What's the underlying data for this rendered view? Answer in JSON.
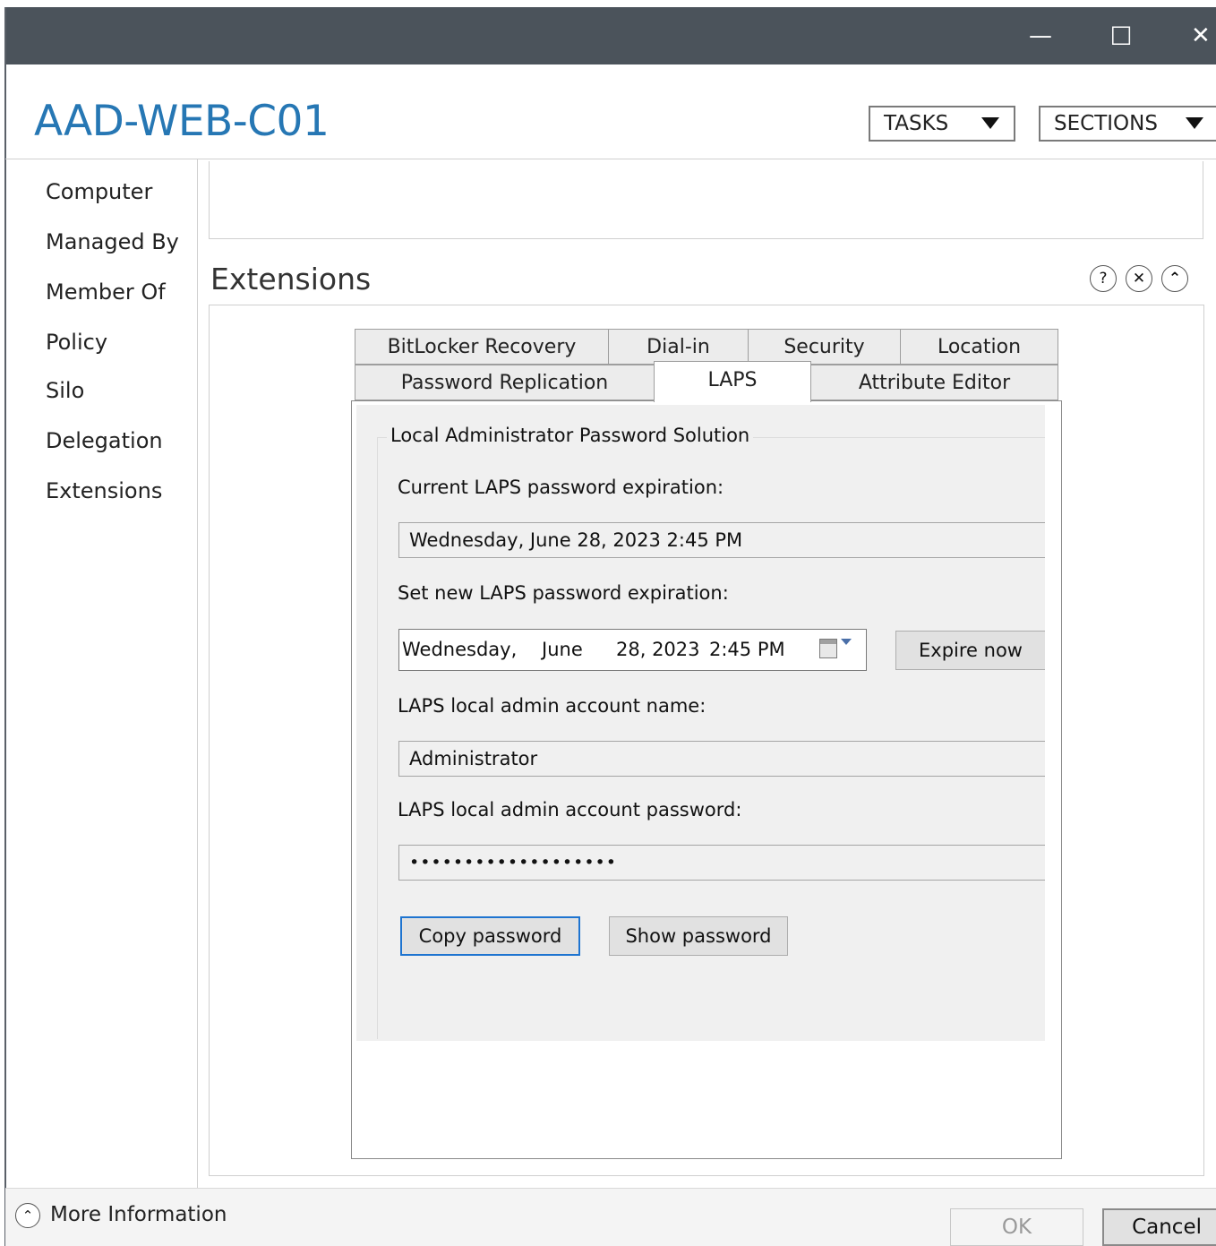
{
  "window": {
    "minimize_glyph": "—",
    "maximize_glyph": "☐",
    "close_glyph": "✕"
  },
  "header": {
    "title": "AAD-WEB-C01",
    "tasks_label": "TASKS",
    "sections_label": "SECTIONS"
  },
  "nav": {
    "items": [
      {
        "label": "Computer"
      },
      {
        "label": "Managed By"
      },
      {
        "label": "Member Of"
      },
      {
        "label": "Policy"
      },
      {
        "label": "Silo"
      },
      {
        "label": "Delegation"
      },
      {
        "label": "Extensions"
      }
    ]
  },
  "extensions": {
    "heading": "Extensions",
    "help_glyph": "?",
    "close_glyph": "✕",
    "collapse_glyph": "⌃",
    "tabs_row1": [
      {
        "label": "BitLocker Recovery"
      },
      {
        "label": "Dial-in"
      },
      {
        "label": "Security"
      },
      {
        "label": "Location"
      }
    ],
    "tabs_row2": [
      {
        "label": "Password Replication"
      },
      {
        "label": "LAPS"
      },
      {
        "label": "Attribute Editor"
      }
    ],
    "active_tab": "LAPS"
  },
  "laps": {
    "group_title": "Local Administrator Password Solution",
    "current_expiration_label": "Current LAPS password expiration:",
    "current_expiration_value": "Wednesday, June 28, 2023 2:45 PM",
    "new_expiration_label": "Set new LAPS password expiration:",
    "date_picker": {
      "weekday": "Wednesday,",
      "month": "June",
      "day_year": "28, 2023",
      "time": "2:45 PM"
    },
    "expire_now_label": "Expire now",
    "account_name_label": "LAPS local admin account name:",
    "account_name_value": "Administrator",
    "password_label": "LAPS local admin account password:",
    "password_value": "•••••••••••••••••••",
    "copy_password_label": "Copy password",
    "show_password_label": "Show password"
  },
  "footer": {
    "expand_glyph": "⌃",
    "more_info_label": "More Information",
    "ok_label": "OK",
    "cancel_label": "Cancel"
  },
  "colors": {
    "titlebar": "#4b535b",
    "title_text": "#2677b4",
    "focus_border": "#1e74d0",
    "panel_bg": "#f0f0f0"
  }
}
